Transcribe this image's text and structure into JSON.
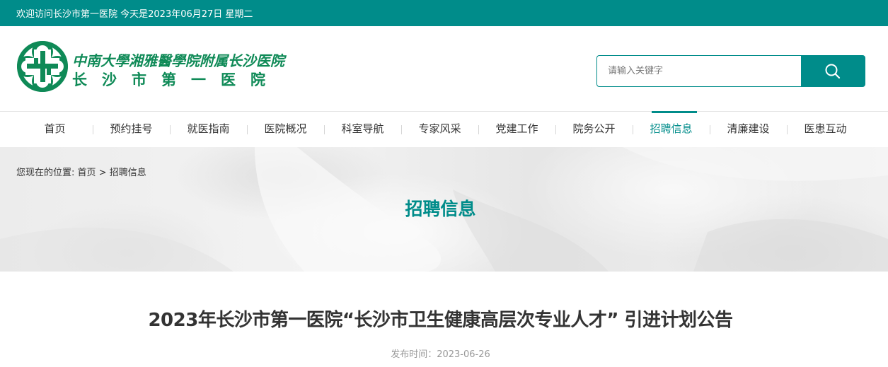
{
  "topbar": {
    "welcome": "欢迎访问长沙市第一医院 今天是2023年06月27日 星期二"
  },
  "header": {
    "logo_line1": "中南大學湘雅醫學院附属长沙医院",
    "logo_line2": "长沙市第一医院",
    "search_placeholder": "请输入关键字",
    "search_icon": "search-icon"
  },
  "nav": {
    "items": [
      {
        "label": "首页"
      },
      {
        "label": "预约挂号"
      },
      {
        "label": "就医指南"
      },
      {
        "label": "医院概况"
      },
      {
        "label": "科室导航"
      },
      {
        "label": "专家风采"
      },
      {
        "label": "党建工作"
      },
      {
        "label": "院务公开"
      },
      {
        "label": "招聘信息",
        "active": true
      },
      {
        "label": "清廉建设"
      },
      {
        "label": "医患互动"
      }
    ]
  },
  "banner": {
    "breadcrumb_prefix": "您现在的位置:",
    "breadcrumb_home": "首页",
    "breadcrumb_sep": " > ",
    "breadcrumb_current": "招聘信息",
    "title": "招聘信息"
  },
  "article": {
    "title": "2023年长沙市第一医院“长沙市卫生健康高层次专业人才” 引进计划公告",
    "published": "发布时间：2023-06-26"
  },
  "colors": {
    "brand": "#008c8a",
    "logo_green": "#0f8a57"
  }
}
